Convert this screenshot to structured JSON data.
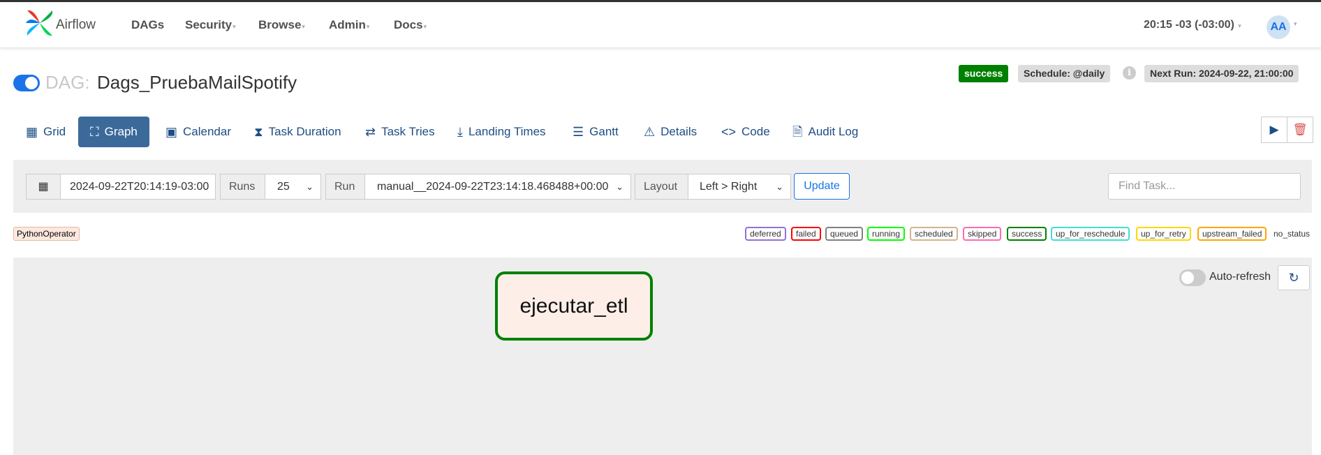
{
  "app": {
    "logo_text": "Airflow"
  },
  "nav": {
    "items": [
      {
        "label": "DAGs"
      },
      {
        "label": "Security"
      },
      {
        "label": "Browse"
      },
      {
        "label": "Admin"
      },
      {
        "label": "Docs"
      }
    ],
    "time": "20:15 -03 (-03:00)",
    "avatar": "AA"
  },
  "dag": {
    "prefix": "DAG:",
    "name": "Dags_PruebaMailSpotify",
    "status": "success",
    "schedule": "Schedule: @daily",
    "next_run": "Next Run: 2024-09-22, 21:00:00"
  },
  "tabs": [
    {
      "label": "Grid"
    },
    {
      "label": "Graph"
    },
    {
      "label": "Calendar"
    },
    {
      "label": "Task Duration"
    },
    {
      "label": "Task Tries"
    },
    {
      "label": "Landing Times"
    },
    {
      "label": "Gantt"
    },
    {
      "label": "Details"
    },
    {
      "label": "Code"
    },
    {
      "label": "Audit Log"
    }
  ],
  "filters": {
    "date": "2024-09-22T20:14:19-03:00",
    "runs_label": "Runs",
    "runs_value": "25",
    "run_label": "Run",
    "run_value": "manual__2024-09-22T23:14:18.468488+00:00",
    "layout_label": "Layout",
    "layout_value": "Left > Right",
    "update": "Update",
    "find_placeholder": "Find Task..."
  },
  "legend": {
    "operator": "PythonOperator",
    "states": [
      {
        "label": "deferred",
        "color": "#9370db"
      },
      {
        "label": "failed",
        "color": "#ff0000"
      },
      {
        "label": "queued",
        "color": "#808080"
      },
      {
        "label": "running",
        "color": "#00ff00"
      },
      {
        "label": "scheduled",
        "color": "#d2b48c"
      },
      {
        "label": "skipped",
        "color": "#ff69b4"
      },
      {
        "label": "success",
        "color": "#008000"
      },
      {
        "label": "up_for_reschedule",
        "color": "#40e0d0"
      },
      {
        "label": "up_for_retry",
        "color": "#ffd700"
      },
      {
        "label": "upstream_failed",
        "color": "#ffa500"
      }
    ],
    "no_status": "no_status"
  },
  "graph": {
    "task": "ejecutar_etl",
    "auto_refresh": "Auto-refresh"
  }
}
